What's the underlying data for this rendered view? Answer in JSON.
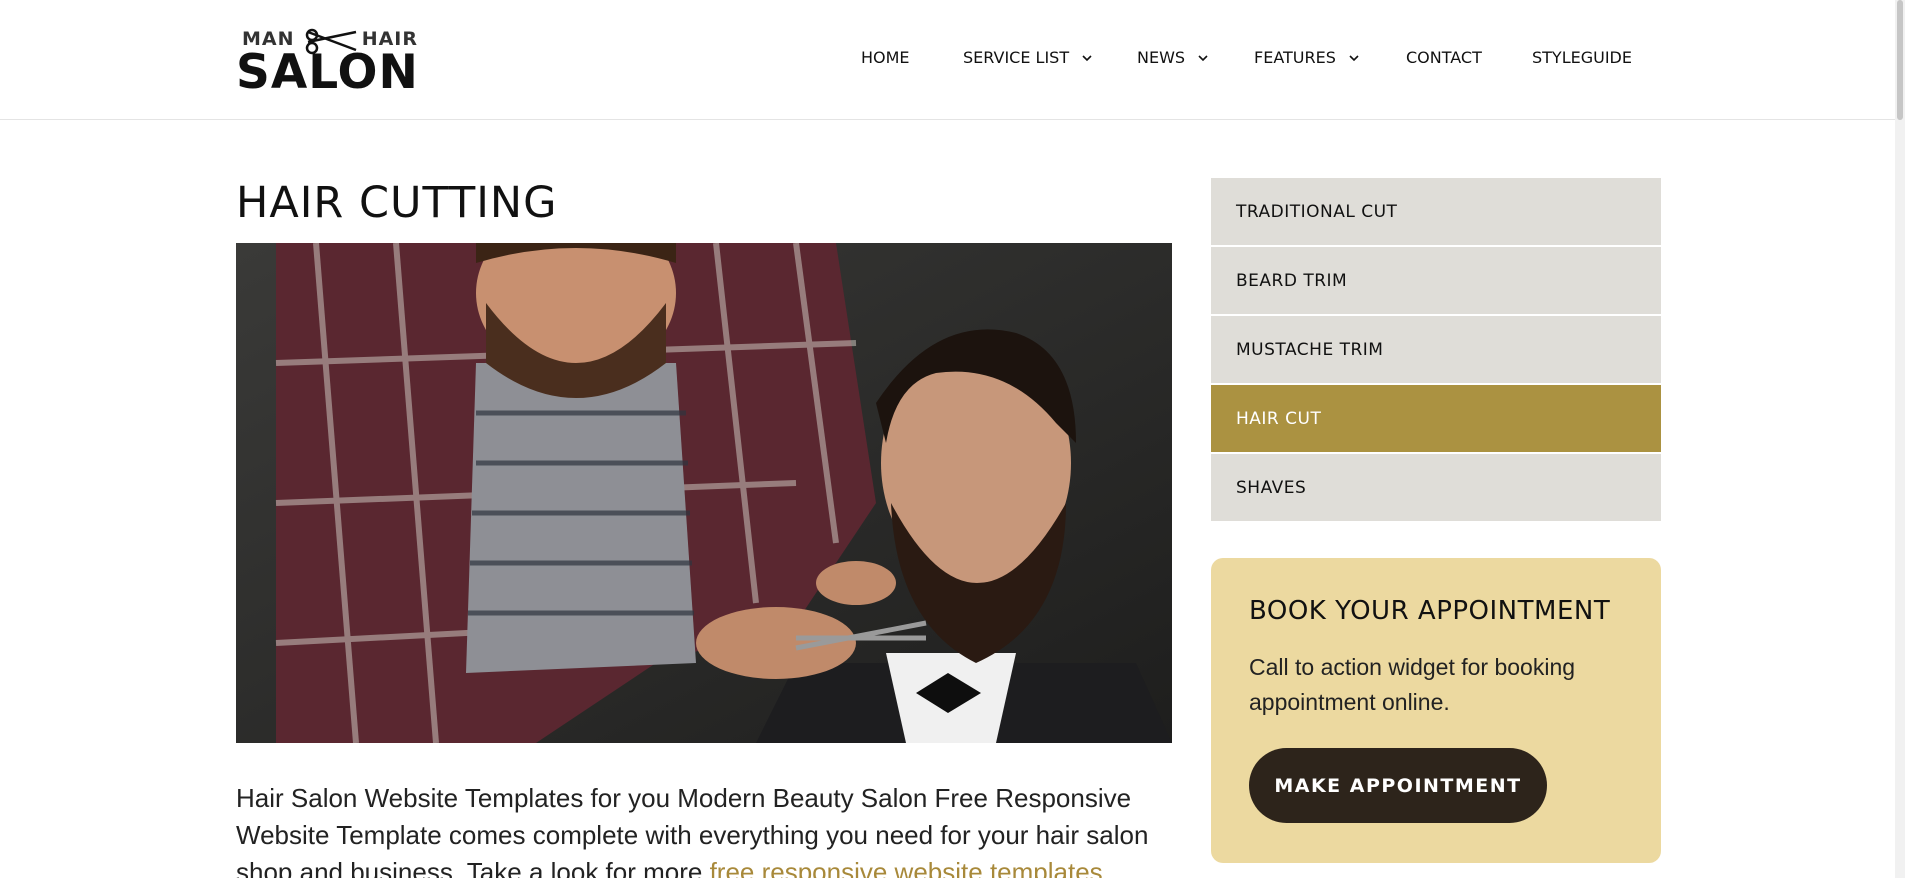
{
  "brand": {
    "top_left": "MAN",
    "top_right": "HAIR",
    "main": "SALON"
  },
  "nav": {
    "items": [
      {
        "label": "HOME",
        "dropdown": false
      },
      {
        "label": "SERVICE LIST",
        "dropdown": true
      },
      {
        "label": "NEWS",
        "dropdown": true
      },
      {
        "label": "FEATURES",
        "dropdown": true
      },
      {
        "label": "CONTACT",
        "dropdown": false
      },
      {
        "label": "STYLEGUIDE",
        "dropdown": false
      }
    ]
  },
  "main": {
    "title": "HAIR CUTTING",
    "hero_image_icon": "barber-photo-icon",
    "body_text": "Hair Salon Website Templates for you Modern Beauty Salon Free Responsive Website Template comes complete with everything you need for your hair salon shop and business. Take a look for more ",
    "body_link": "free responsive website templates."
  },
  "sidebar": {
    "services": [
      {
        "label": "TRADITIONAL CUT",
        "active": false
      },
      {
        "label": "BEARD TRIM",
        "active": false
      },
      {
        "label": "MUSTACHE TRIM",
        "active": false
      },
      {
        "label": "HAIR CUT",
        "active": true
      },
      {
        "label": "SHAVES",
        "active": false
      }
    ],
    "booking": {
      "title": "BOOK YOUR APPOINTMENT",
      "text": "Call to action widget for booking appointment online.",
      "button": "MAKE APPOINTMENT"
    }
  },
  "colors": {
    "accent": "#ab9241",
    "link": "#a8893a",
    "service_bg": "#dfddd8",
    "booking_bg": "#ecd9a0",
    "button_bg": "#2d241b"
  }
}
